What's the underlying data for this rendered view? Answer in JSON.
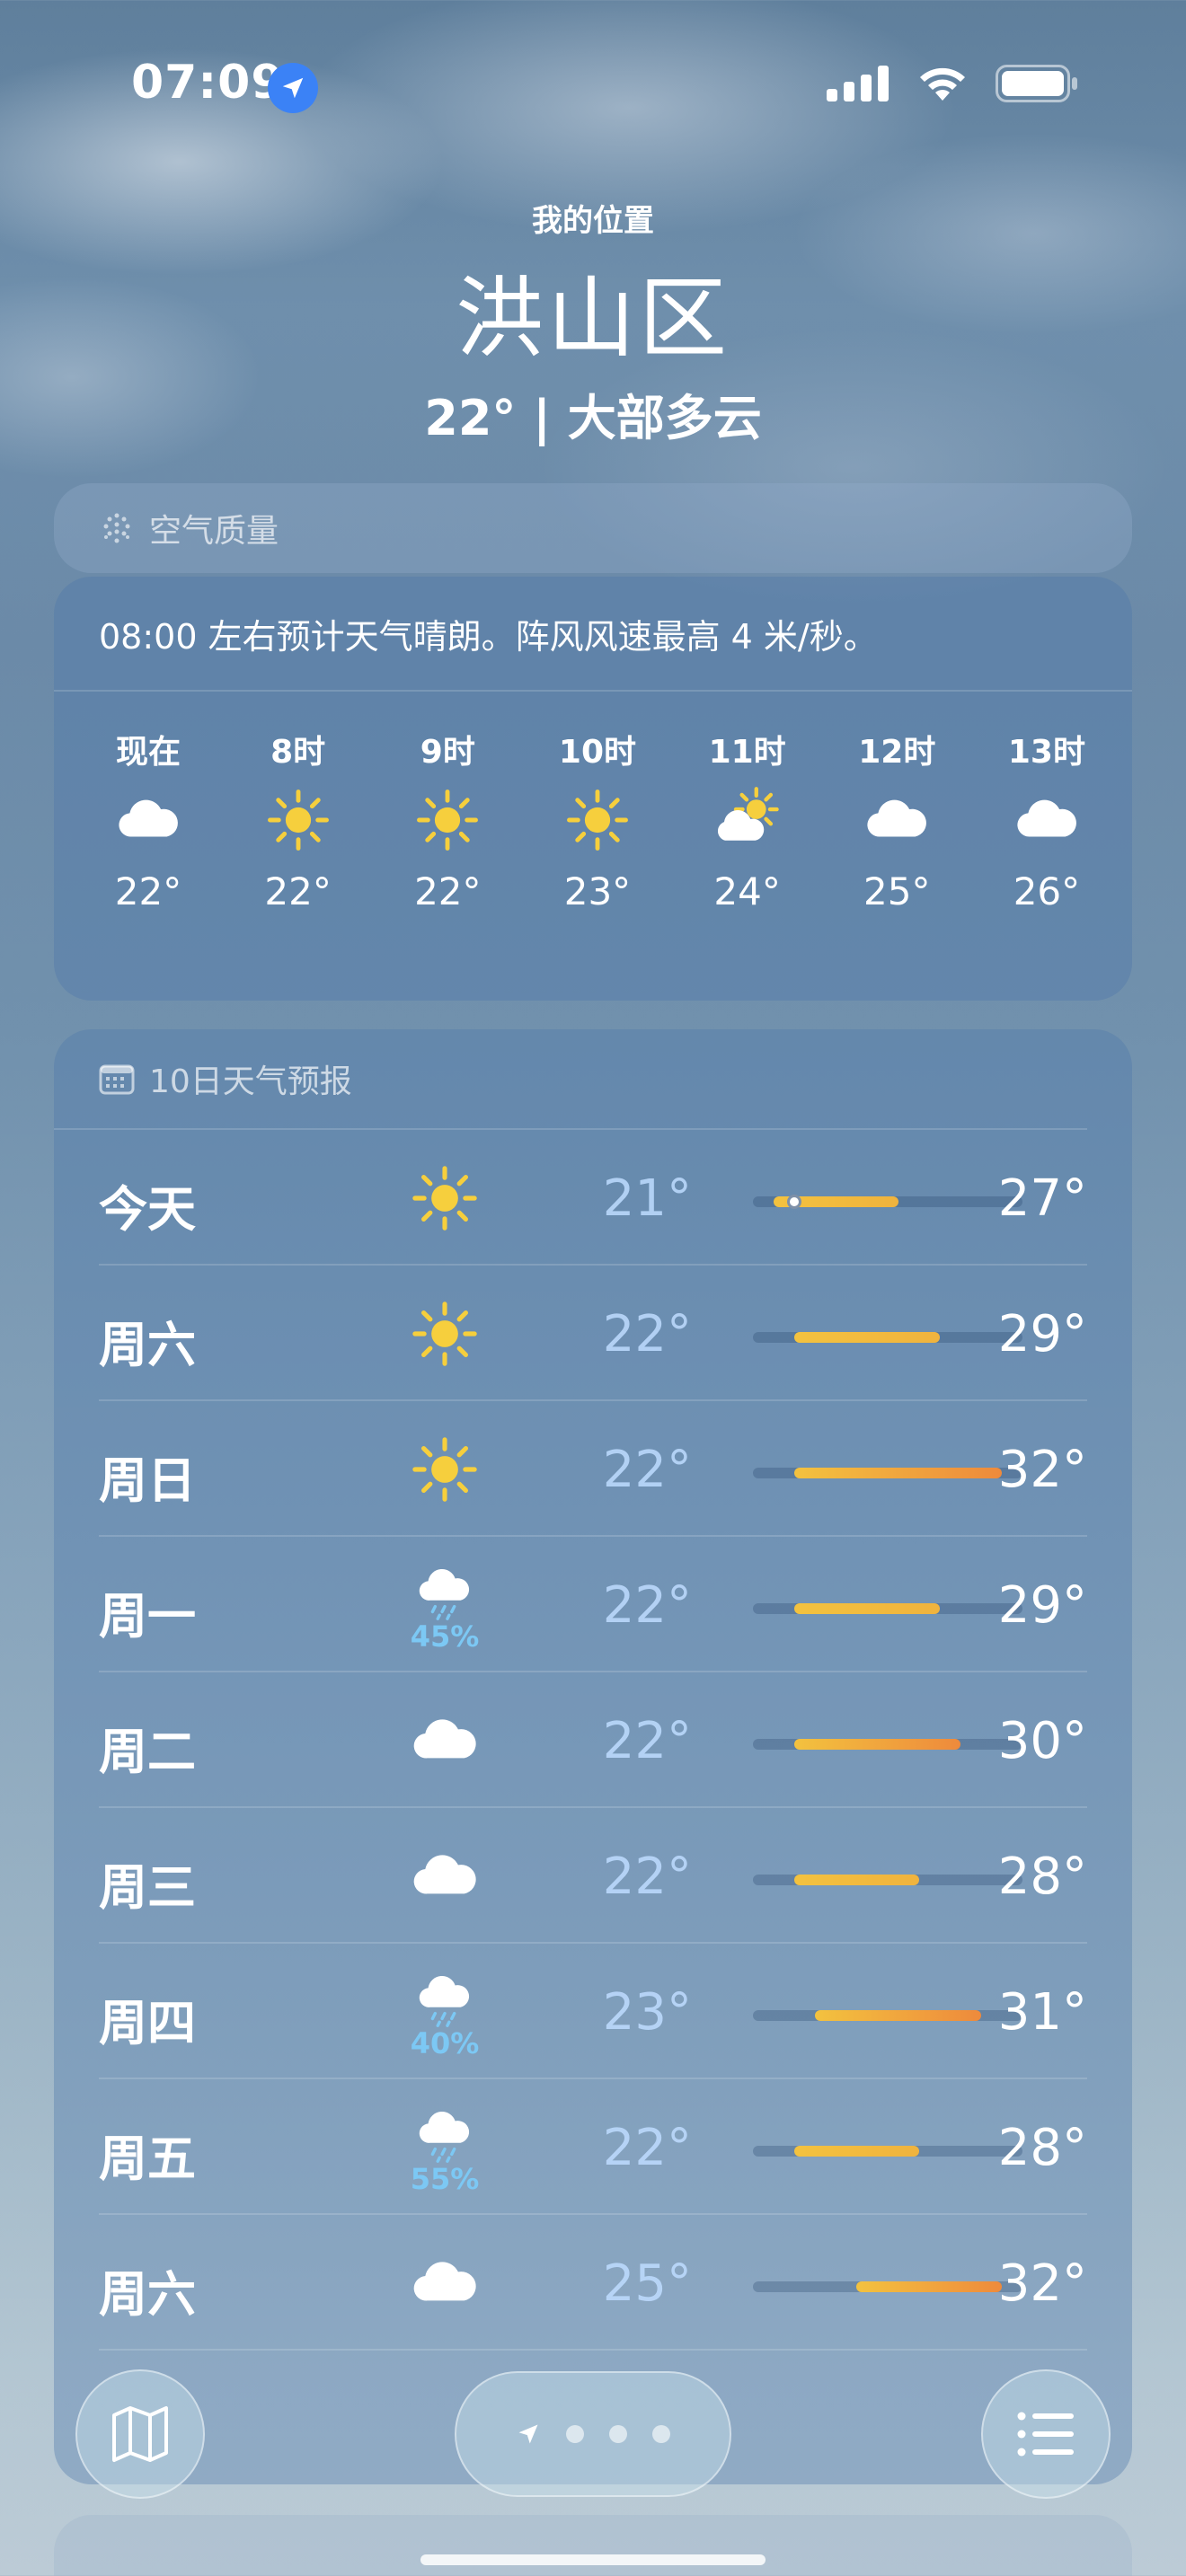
{
  "status_bar": {
    "time": "07:09"
  },
  "header": {
    "location_label": "我的位置",
    "city": "洪山区",
    "summary": "22° | 大部多云"
  },
  "air_quality": {
    "title": "空气质量"
  },
  "hourly": {
    "summary": "08:00 左右预计天气晴朗。阵风风速最高 4 米/秒。",
    "items": [
      {
        "label": "现在",
        "icon": "cloud-icon",
        "temp": "22°"
      },
      {
        "label": "8时",
        "icon": "sun-icon",
        "temp": "22°"
      },
      {
        "label": "9时",
        "icon": "sun-icon",
        "temp": "22°"
      },
      {
        "label": "10时",
        "icon": "sun-icon",
        "temp": "23°"
      },
      {
        "label": "11时",
        "icon": "partly-cloudy-icon",
        "temp": "24°"
      },
      {
        "label": "12时",
        "icon": "cloud-icon",
        "temp": "25°"
      },
      {
        "label": "13时",
        "icon": "cloud-icon",
        "temp": "26°"
      }
    ]
  },
  "daily": {
    "title": "10日天气预报",
    "range_min": 20,
    "range_max": 33,
    "days": [
      {
        "name": "今天",
        "icon": "sun-icon",
        "precip": "",
        "low": "21°",
        "high": "27°",
        "lo": 21,
        "hi": 27,
        "current": 22
      },
      {
        "name": "周六",
        "icon": "sun-icon",
        "precip": "",
        "low": "22°",
        "high": "29°",
        "lo": 22,
        "hi": 29
      },
      {
        "name": "周日",
        "icon": "sun-icon",
        "precip": "",
        "low": "22°",
        "high": "32°",
        "lo": 22,
        "hi": 32
      },
      {
        "name": "周一",
        "icon": "rain-icon",
        "precip": "45%",
        "low": "22°",
        "high": "29°",
        "lo": 22,
        "hi": 29
      },
      {
        "name": "周二",
        "icon": "cloud-icon",
        "precip": "",
        "low": "22°",
        "high": "30°",
        "lo": 22,
        "hi": 30
      },
      {
        "name": "周三",
        "icon": "cloud-icon",
        "precip": "",
        "low": "22°",
        "high": "28°",
        "lo": 22,
        "hi": 28
      },
      {
        "name": "周四",
        "icon": "rain-icon",
        "precip": "40%",
        "low": "23°",
        "high": "31°",
        "lo": 23,
        "hi": 31
      },
      {
        "name": "周五",
        "icon": "rain-icon",
        "precip": "55%",
        "low": "22°",
        "high": "28°",
        "lo": 22,
        "hi": 28
      },
      {
        "name": "周六",
        "icon": "cloud-icon",
        "precip": "",
        "low": "25°",
        "high": "32°",
        "lo": 25,
        "hi": 32
      }
    ]
  },
  "colors": {
    "sun": "#f6cf3d",
    "bar_cool": "#f3c23f",
    "bar_warm": "#ee8a3c",
    "precip": "#7cc8f4"
  }
}
